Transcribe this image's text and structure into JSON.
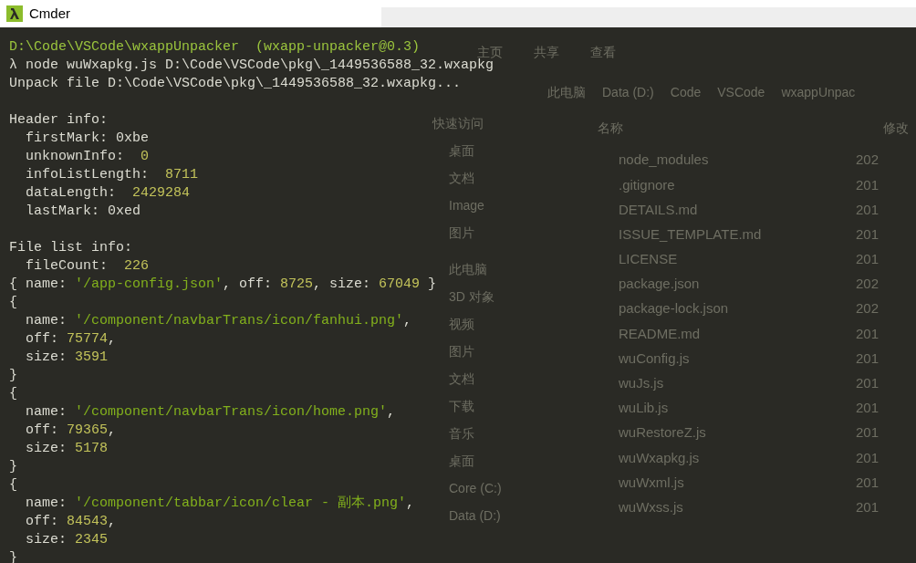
{
  "window": {
    "title": "Cmder"
  },
  "terminal": {
    "lines": [
      {
        "kind": "text",
        "segments": [
          {
            "kind": "path",
            "text": "D:\\Code\\VSCode\\wxappUnpacker"
          },
          {
            "kind": "path",
            "text": "  (wxapp-unpacker@0.3)"
          }
        ]
      },
      {
        "kind": "text",
        "segments": [
          {
            "kind": "plain",
            "text": "λ node wuWxapkg.js D:\\Code\\VSCode\\pkg\\_1449536588_32.wxapkg"
          }
        ]
      },
      {
        "kind": "text",
        "segments": [
          {
            "kind": "plain",
            "text": "Unpack file D:\\Code\\VSCode\\pkg\\_1449536588_32.wxapkg..."
          }
        ]
      },
      {
        "kind": "blank"
      },
      {
        "kind": "text",
        "segments": [
          {
            "kind": "plain",
            "text": "Header info:"
          }
        ]
      },
      {
        "kind": "text",
        "segments": [
          {
            "kind": "plain",
            "text": "  firstMark: 0xbe"
          }
        ]
      },
      {
        "kind": "text",
        "segments": [
          {
            "kind": "plain",
            "text": "  unknownInfo:  "
          },
          {
            "kind": "number",
            "text": "0"
          }
        ]
      },
      {
        "kind": "text",
        "segments": [
          {
            "kind": "plain",
            "text": "  infoListLength:  "
          },
          {
            "kind": "number",
            "text": "8711"
          }
        ]
      },
      {
        "kind": "text",
        "segments": [
          {
            "kind": "plain",
            "text": "  dataLength:  "
          },
          {
            "kind": "number",
            "text": "2429284"
          }
        ]
      },
      {
        "kind": "text",
        "segments": [
          {
            "kind": "plain",
            "text": "  lastMark: 0xed"
          }
        ]
      },
      {
        "kind": "blank"
      },
      {
        "kind": "text",
        "segments": [
          {
            "kind": "plain",
            "text": "File list info:"
          }
        ]
      },
      {
        "kind": "text",
        "segments": [
          {
            "kind": "plain",
            "text": "  fileCount:  "
          },
          {
            "kind": "number",
            "text": "226"
          }
        ]
      },
      {
        "kind": "text",
        "segments": [
          {
            "kind": "plain",
            "text": "{ name: "
          },
          {
            "kind": "string",
            "text": "'/app-config.json'"
          },
          {
            "kind": "plain",
            "text": ", off: "
          },
          {
            "kind": "number",
            "text": "8725"
          },
          {
            "kind": "plain",
            "text": ", size: "
          },
          {
            "kind": "number",
            "text": "67049"
          },
          {
            "kind": "plain",
            "text": " }"
          }
        ]
      },
      {
        "kind": "text",
        "segments": [
          {
            "kind": "plain",
            "text": "{"
          }
        ]
      },
      {
        "kind": "text",
        "segments": [
          {
            "kind": "plain",
            "text": "  name: "
          },
          {
            "kind": "string",
            "text": "'/component/navbarTrans/icon/fanhui.png'"
          },
          {
            "kind": "plain",
            "text": ","
          }
        ]
      },
      {
        "kind": "text",
        "segments": [
          {
            "kind": "plain",
            "text": "  off: "
          },
          {
            "kind": "number",
            "text": "75774"
          },
          {
            "kind": "plain",
            "text": ","
          }
        ]
      },
      {
        "kind": "text",
        "segments": [
          {
            "kind": "plain",
            "text": "  size: "
          },
          {
            "kind": "number",
            "text": "3591"
          }
        ]
      },
      {
        "kind": "text",
        "segments": [
          {
            "kind": "plain",
            "text": "}"
          }
        ]
      },
      {
        "kind": "text",
        "segments": [
          {
            "kind": "plain",
            "text": "{"
          }
        ]
      },
      {
        "kind": "text",
        "segments": [
          {
            "kind": "plain",
            "text": "  name: "
          },
          {
            "kind": "string",
            "text": "'/component/navbarTrans/icon/home.png'"
          },
          {
            "kind": "plain",
            "text": ","
          }
        ]
      },
      {
        "kind": "text",
        "segments": [
          {
            "kind": "plain",
            "text": "  off: "
          },
          {
            "kind": "number",
            "text": "79365"
          },
          {
            "kind": "plain",
            "text": ","
          }
        ]
      },
      {
        "kind": "text",
        "segments": [
          {
            "kind": "plain",
            "text": "  size: "
          },
          {
            "kind": "number",
            "text": "5178"
          }
        ]
      },
      {
        "kind": "text",
        "segments": [
          {
            "kind": "plain",
            "text": "}"
          }
        ]
      },
      {
        "kind": "text",
        "segments": [
          {
            "kind": "plain",
            "text": "{"
          }
        ]
      },
      {
        "kind": "text",
        "segments": [
          {
            "kind": "plain",
            "text": "  name: "
          },
          {
            "kind": "string",
            "text": "'/component/tabbar/icon/clear - 副本.png'"
          },
          {
            "kind": "plain",
            "text": ","
          }
        ]
      },
      {
        "kind": "text",
        "segments": [
          {
            "kind": "plain",
            "text": "  off: "
          },
          {
            "kind": "number",
            "text": "84543"
          },
          {
            "kind": "plain",
            "text": ","
          }
        ]
      },
      {
        "kind": "text",
        "segments": [
          {
            "kind": "plain",
            "text": "  size: "
          },
          {
            "kind": "number",
            "text": "2345"
          }
        ]
      },
      {
        "kind": "text",
        "segments": [
          {
            "kind": "plain",
            "text": "}"
          }
        ]
      }
    ]
  },
  "background_window": {
    "ribbon_tabs": [
      "主页",
      "共享",
      "查看"
    ],
    "breadcrumb": [
      "此电脑",
      "Data (D:)",
      "Code",
      "VSCode",
      "wxappUnpac"
    ],
    "nav_items": [
      "快速访问",
      "桌面",
      "文档",
      "Image",
      "图片",
      "此电脑",
      "3D 对象",
      "视频",
      "图片",
      "文档",
      "下载",
      "音乐",
      "桌面",
      "Core (C:)",
      "Data (D:)"
    ],
    "columns": [
      "名称",
      "修改"
    ],
    "files": [
      {
        "name": "node_modules",
        "date": "202"
      },
      {
        "name": ".gitignore",
        "date": "201"
      },
      {
        "name": "DETAILS.md",
        "date": "201"
      },
      {
        "name": "ISSUE_TEMPLATE.md",
        "date": "201"
      },
      {
        "name": "LICENSE",
        "date": "201"
      },
      {
        "name": "package.json",
        "date": "202"
      },
      {
        "name": "package-lock.json",
        "date": "202"
      },
      {
        "name": "README.md",
        "date": "201"
      },
      {
        "name": "wuConfig.js",
        "date": "201"
      },
      {
        "name": "wuJs.js",
        "date": "201"
      },
      {
        "name": "wuLib.js",
        "date": "201"
      },
      {
        "name": "wuRestoreZ.js",
        "date": "201"
      },
      {
        "name": "wuWxapkg.js",
        "date": "201"
      },
      {
        "name": "wuWxml.js",
        "date": "201"
      },
      {
        "name": "wuWxss.js",
        "date": "201"
      }
    ]
  }
}
